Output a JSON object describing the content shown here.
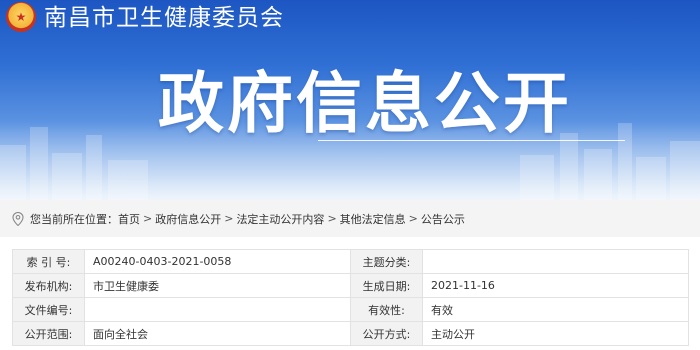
{
  "header": {
    "site_name": "南昌市卫生健康委员会",
    "banner_title": "政府信息公开"
  },
  "breadcrumb": {
    "prefix": "您当前所在位置：",
    "items": [
      "首页",
      "政府信息公开",
      "法定主动公开内容",
      "其他法定信息",
      "公告公示"
    ],
    "separator": ">"
  },
  "info": {
    "rows": [
      {
        "label1": "索 引 号:",
        "value1": "A00240-0403-2021-0058",
        "label2": "主题分类:",
        "value2": ""
      },
      {
        "label1": "发布机构:",
        "value1": "市卫生健康委",
        "label2": "生成日期:",
        "value2": "2021-11-16"
      },
      {
        "label1": "文件编号:",
        "value1": "",
        "label2": "有效性:",
        "value2": "有效"
      },
      {
        "label1": "公开范围:",
        "value1": "面向全社会",
        "label2": "公开方式:",
        "value2": "主动公开"
      }
    ]
  },
  "colors": {
    "banner_top": "#1d56c2",
    "banner_bottom": "#dbe8f8",
    "label_bg": "#f2f2f2",
    "breadcrumb_bg": "#f4f4f4"
  },
  "icons": {
    "emblem": "national-emblem-icon",
    "location": "location-pin-icon"
  }
}
